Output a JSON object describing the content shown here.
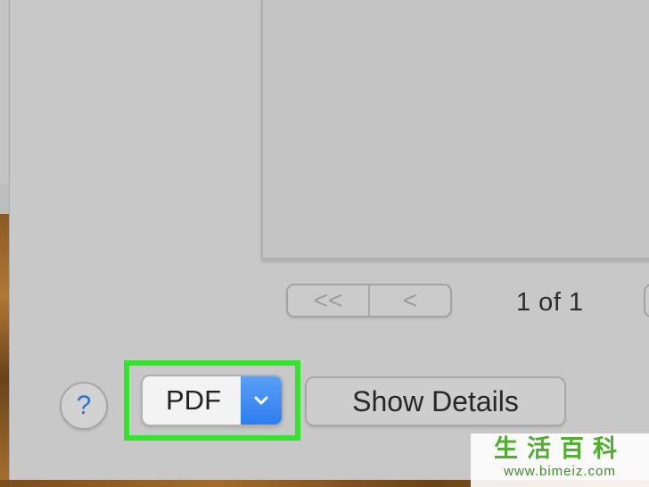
{
  "pager": {
    "first_label": "<<",
    "prev_label": "<",
    "page_count": "1 of 1"
  },
  "help": {
    "label": "?"
  },
  "pdf_menu": {
    "label": "PDF",
    "arrow_icon": "chevron-down-icon"
  },
  "show_details": {
    "label": "Show Details"
  },
  "highlight_color": "#34e32c",
  "accent_color": "#2f7cf0",
  "watermark": {
    "main": "生活百科",
    "url": "www.bimeiz.com"
  }
}
